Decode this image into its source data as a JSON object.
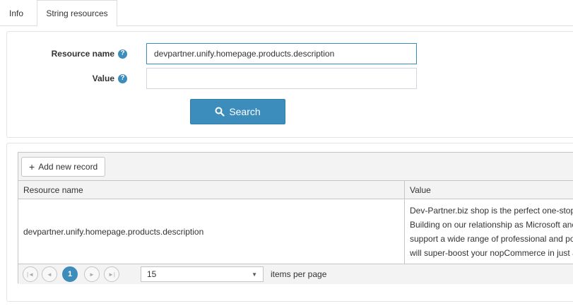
{
  "tabs": [
    {
      "label": "Info"
    },
    {
      "label": "String resources"
    }
  ],
  "search_form": {
    "resource_name_label": "Resource name",
    "resource_name_value": "devpartner.unify.homepage.products.description",
    "value_label": "Value",
    "value_value": "",
    "search_button": "Search",
    "help_glyph": "?"
  },
  "grid": {
    "add_button": "Add new record",
    "columns": [
      "Resource name",
      "Value"
    ],
    "rows": [
      {
        "resource_name": "devpartner.unify.homepage.products.description",
        "value_lines": [
          "Dev-Partner.biz shop is the perfect one-stop",
          "Building on our relationship as Microsoft and",
          "support a wide range of professional and pow",
          "will super-boost your nopCommerce in just a"
        ]
      }
    ],
    "pager": {
      "current_page": "1",
      "page_size": "15",
      "items_per_page_label": "items per page"
    }
  },
  "colors": {
    "accent": "#3c8dbc",
    "border": "#c5c5c5",
    "header_bg": "#f3f3f3"
  },
  "icons": [
    "help-icon",
    "search-icon",
    "plus-icon",
    "first-page-icon",
    "prev-page-icon",
    "next-page-icon",
    "last-page-icon",
    "caret-down-icon"
  ]
}
